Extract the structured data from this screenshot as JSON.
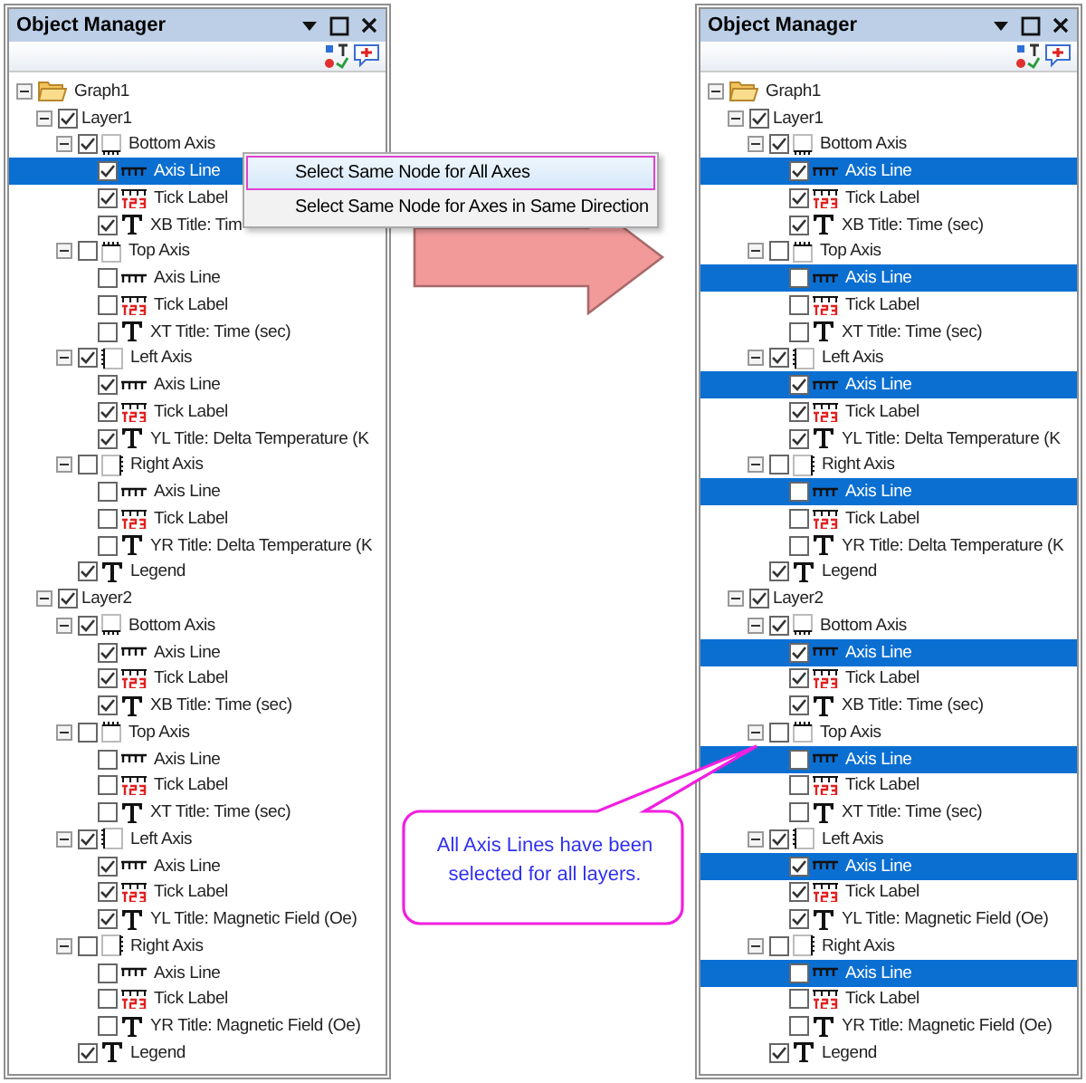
{
  "panels": [
    {
      "title": "Object Manager",
      "tree": [
        {
          "kind": "graph",
          "label": "Graph1",
          "selected": false,
          "expanded": true,
          "children": [
            {
              "kind": "layer",
              "label": "Layer1",
              "checked": true,
              "selected": false,
              "expanded": true,
              "children": [
                {
                  "kind": "axis-bottom",
                  "label": "Bottom Axis",
                  "checked": true,
                  "selected": false,
                  "expanded": true,
                  "children": [
                    {
                      "kind": "axis-line",
                      "label": "Axis Line",
                      "checked": true,
                      "selected": true
                    },
                    {
                      "kind": "tick-label",
                      "label": "Tick Label",
                      "checked": true,
                      "selected": false
                    },
                    {
                      "kind": "title",
                      "label": "XB Title: Tim",
                      "checked": true,
                      "selected": false
                    }
                  ]
                },
                {
                  "kind": "axis-top",
                  "label": "Top Axis",
                  "checked": false,
                  "selected": false,
                  "expanded": true,
                  "children": [
                    {
                      "kind": "axis-line",
                      "label": "Axis Line",
                      "checked": false,
                      "selected": false
                    },
                    {
                      "kind": "tick-label",
                      "label": "Tick Label",
                      "checked": false,
                      "selected": false
                    },
                    {
                      "kind": "title",
                      "label": "XT Title: Time (sec)",
                      "checked": false,
                      "selected": false
                    }
                  ]
                },
                {
                  "kind": "axis-left",
                  "label": "Left Axis",
                  "checked": true,
                  "selected": false,
                  "expanded": true,
                  "children": [
                    {
                      "kind": "axis-line",
                      "label": "Axis Line",
                      "checked": true,
                      "selected": false
                    },
                    {
                      "kind": "tick-label",
                      "label": "Tick Label",
                      "checked": true,
                      "selected": false
                    },
                    {
                      "kind": "title",
                      "label": "YL Title: Delta Temperature (K",
                      "checked": true,
                      "selected": false
                    }
                  ]
                },
                {
                  "kind": "axis-right",
                  "label": "Right Axis",
                  "checked": false,
                  "selected": false,
                  "expanded": true,
                  "children": [
                    {
                      "kind": "axis-line",
                      "label": "Axis Line",
                      "checked": false,
                      "selected": false
                    },
                    {
                      "kind": "tick-label",
                      "label": "Tick Label",
                      "checked": false,
                      "selected": false
                    },
                    {
                      "kind": "title",
                      "label": "YR Title: Delta Temperature (K",
                      "checked": false,
                      "selected": false
                    }
                  ]
                },
                {
                  "kind": "legend",
                  "label": "Legend",
                  "checked": true,
                  "selected": false
                }
              ]
            },
            {
              "kind": "layer",
              "label": "Layer2",
              "checked": true,
              "selected": false,
              "expanded": true,
              "children": [
                {
                  "kind": "axis-bottom",
                  "label": "Bottom Axis",
                  "checked": true,
                  "selected": false,
                  "expanded": true,
                  "children": [
                    {
                      "kind": "axis-line",
                      "label": "Axis Line",
                      "checked": true,
                      "selected": false
                    },
                    {
                      "kind": "tick-label",
                      "label": "Tick Label",
                      "checked": true,
                      "selected": false
                    },
                    {
                      "kind": "title",
                      "label": "XB Title: Time (sec)",
                      "checked": true,
                      "selected": false
                    }
                  ]
                },
                {
                  "kind": "axis-top",
                  "label": "Top Axis",
                  "checked": false,
                  "selected": false,
                  "expanded": true,
                  "children": [
                    {
                      "kind": "axis-line",
                      "label": "Axis Line",
                      "checked": false,
                      "selected": false
                    },
                    {
                      "kind": "tick-label",
                      "label": "Tick Label",
                      "checked": false,
                      "selected": false
                    },
                    {
                      "kind": "title",
                      "label": "XT Title: Time (sec)",
                      "checked": false,
                      "selected": false
                    }
                  ]
                },
                {
                  "kind": "axis-left",
                  "label": "Left Axis",
                  "checked": true,
                  "selected": false,
                  "expanded": true,
                  "children": [
                    {
                      "kind": "axis-line",
                      "label": "Axis Line",
                      "checked": true,
                      "selected": false
                    },
                    {
                      "kind": "tick-label",
                      "label": "Tick Label",
                      "checked": true,
                      "selected": false
                    },
                    {
                      "kind": "title",
                      "label": "YL Title: Magnetic Field (Oe)",
                      "checked": true,
                      "selected": false
                    }
                  ]
                },
                {
                  "kind": "axis-right",
                  "label": "Right Axis",
                  "checked": false,
                  "selected": false,
                  "expanded": true,
                  "children": [
                    {
                      "kind": "axis-line",
                      "label": "Axis Line",
                      "checked": false,
                      "selected": false
                    },
                    {
                      "kind": "tick-label",
                      "label": "Tick Label",
                      "checked": false,
                      "selected": false
                    },
                    {
                      "kind": "title",
                      "label": "YR Title: Magnetic Field (Oe)",
                      "checked": false,
                      "selected": false
                    }
                  ]
                },
                {
                  "kind": "legend",
                  "label": "Legend",
                  "checked": true,
                  "selected": false
                }
              ]
            }
          ]
        }
      ],
      "context_menu": [
        {
          "label": "Select Same Node for All Axes",
          "selected": true
        },
        {
          "label": "Select Same Node for Axes in Same Direction",
          "selected": false
        }
      ]
    },
    {
      "title": "Object Manager",
      "tree": [
        {
          "kind": "graph",
          "label": "Graph1",
          "selected": false,
          "expanded": true,
          "children": [
            {
              "kind": "layer",
              "label": "Layer1",
              "checked": true,
              "selected": false,
              "expanded": true,
              "children": [
                {
                  "kind": "axis-bottom",
                  "label": "Bottom Axis",
                  "checked": true,
                  "selected": false,
                  "expanded": true,
                  "children": [
                    {
                      "kind": "axis-line",
                      "label": "Axis Line",
                      "checked": true,
                      "selected": true
                    },
                    {
                      "kind": "tick-label",
                      "label": "Tick Label",
                      "checked": true,
                      "selected": false
                    },
                    {
                      "kind": "title",
                      "label": "XB Title: Time (sec)",
                      "checked": true,
                      "selected": false
                    }
                  ]
                },
                {
                  "kind": "axis-top",
                  "label": "Top Axis",
                  "checked": false,
                  "selected": false,
                  "expanded": true,
                  "children": [
                    {
                      "kind": "axis-line",
                      "label": "Axis Line",
                      "checked": false,
                      "selected": true
                    },
                    {
                      "kind": "tick-label",
                      "label": "Tick Label",
                      "checked": false,
                      "selected": false
                    },
                    {
                      "kind": "title",
                      "label": "XT Title: Time (sec)",
                      "checked": false,
                      "selected": false
                    }
                  ]
                },
                {
                  "kind": "axis-left",
                  "label": "Left Axis",
                  "checked": true,
                  "selected": false,
                  "expanded": true,
                  "children": [
                    {
                      "kind": "axis-line",
                      "label": "Axis Line",
                      "checked": true,
                      "selected": true
                    },
                    {
                      "kind": "tick-label",
                      "label": "Tick Label",
                      "checked": true,
                      "selected": false
                    },
                    {
                      "kind": "title",
                      "label": "YL Title: Delta Temperature (K",
                      "checked": true,
                      "selected": false
                    }
                  ]
                },
                {
                  "kind": "axis-right",
                  "label": "Right Axis",
                  "checked": false,
                  "selected": false,
                  "expanded": true,
                  "children": [
                    {
                      "kind": "axis-line",
                      "label": "Axis Line",
                      "checked": false,
                      "selected": true
                    },
                    {
                      "kind": "tick-label",
                      "label": "Tick Label",
                      "checked": false,
                      "selected": false
                    },
                    {
                      "kind": "title",
                      "label": "YR Title: Delta Temperature (K",
                      "checked": false,
                      "selected": false
                    }
                  ]
                },
                {
                  "kind": "legend",
                  "label": "Legend",
                  "checked": true,
                  "selected": false
                }
              ]
            },
            {
              "kind": "layer",
              "label": "Layer2",
              "checked": true,
              "selected": false,
              "expanded": true,
              "children": [
                {
                  "kind": "axis-bottom",
                  "label": "Bottom Axis",
                  "checked": true,
                  "selected": false,
                  "expanded": true,
                  "children": [
                    {
                      "kind": "axis-line",
                      "label": "Axis Line",
                      "checked": true,
                      "selected": true
                    },
                    {
                      "kind": "tick-label",
                      "label": "Tick Label",
                      "checked": true,
                      "selected": false
                    },
                    {
                      "kind": "title",
                      "label": "XB Title: Time (sec)",
                      "checked": true,
                      "selected": false
                    }
                  ]
                },
                {
                  "kind": "axis-top",
                  "label": "Top Axis",
                  "checked": false,
                  "selected": false,
                  "expanded": true,
                  "children": [
                    {
                      "kind": "axis-line",
                      "label": "Axis Line",
                      "checked": false,
                      "selected": true
                    },
                    {
                      "kind": "tick-label",
                      "label": "Tick Label",
                      "checked": false,
                      "selected": false
                    },
                    {
                      "kind": "title",
                      "label": "XT Title: Time (sec)",
                      "checked": false,
                      "selected": false
                    }
                  ]
                },
                {
                  "kind": "axis-left",
                  "label": "Left Axis",
                  "checked": true,
                  "selected": false,
                  "expanded": true,
                  "children": [
                    {
                      "kind": "axis-line",
                      "label": "Axis Line",
                      "checked": true,
                      "selected": true
                    },
                    {
                      "kind": "tick-label",
                      "label": "Tick Label",
                      "checked": true,
                      "selected": false
                    },
                    {
                      "kind": "title",
                      "label": "YL Title: Magnetic Field (Oe)",
                      "checked": true,
                      "selected": false
                    }
                  ]
                },
                {
                  "kind": "axis-right",
                  "label": "Right Axis",
                  "checked": false,
                  "selected": false,
                  "expanded": true,
                  "children": [
                    {
                      "kind": "axis-line",
                      "label": "Axis Line",
                      "checked": false,
                      "selected": true
                    },
                    {
                      "kind": "tick-label",
                      "label": "Tick Label",
                      "checked": false,
                      "selected": false
                    },
                    {
                      "kind": "title",
                      "label": "YR Title: Magnetic Field (Oe)",
                      "checked": false,
                      "selected": false
                    }
                  ]
                },
                {
                  "kind": "legend",
                  "label": "Legend",
                  "checked": true,
                  "selected": false
                }
              ]
            }
          ]
        }
      ]
    }
  ],
  "callout": {
    "text": "All Axis Lines have been selected for all layers."
  }
}
